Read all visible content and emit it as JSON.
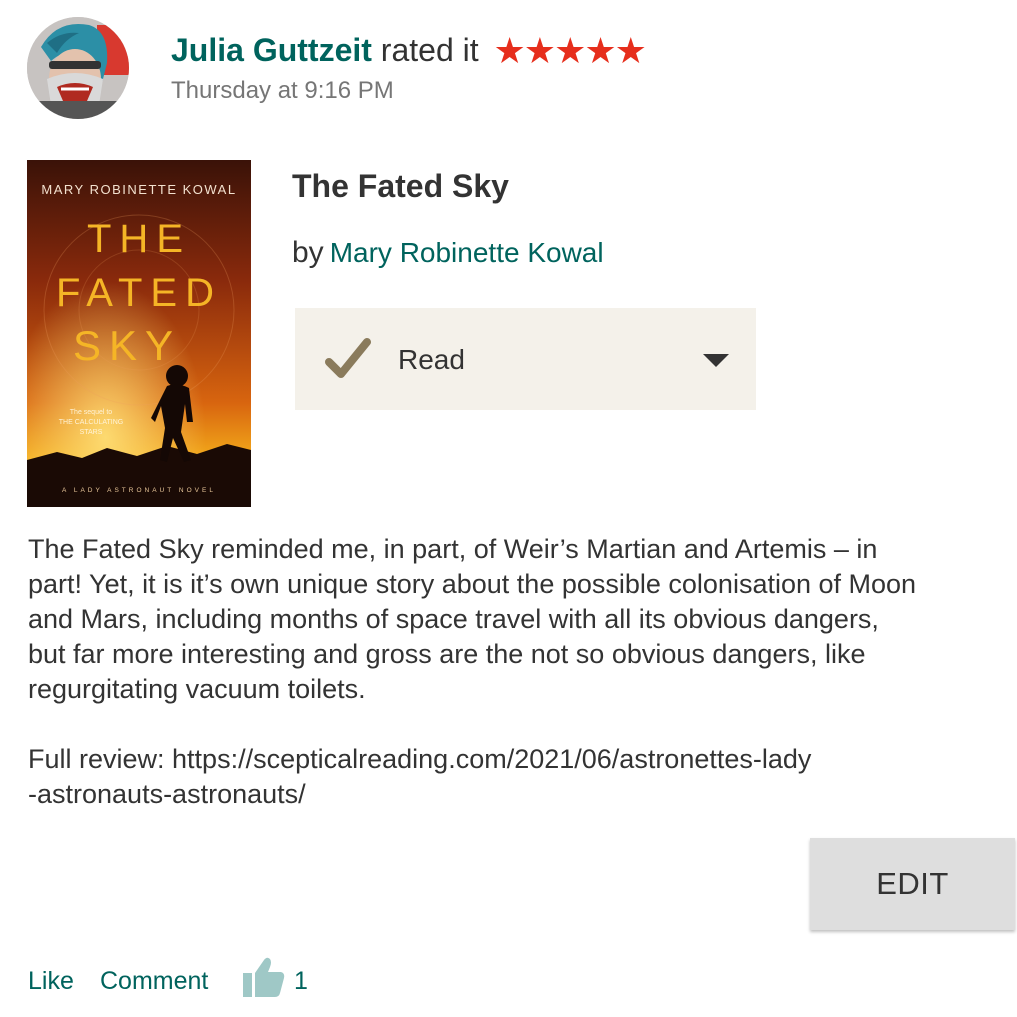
{
  "update": {
    "user_name": "Julia Guttzeit",
    "action_text": "rated it",
    "stars": "★★★★★",
    "timestamp": "Thursday at 9:16 PM"
  },
  "book": {
    "title": "The Fated Sky",
    "by_label": "by",
    "author": "Mary Robinette Kowal",
    "cover": {
      "author_line": "MARY ROBINETTE KOWAL",
      "title_line_1": "THE",
      "title_line_2": "FATED",
      "title_line_3": "SKY",
      "tagline_1": "The sequel to",
      "tagline_2": "THE CALCULATING",
      "tagline_3": "STARS",
      "series": "A LADY ASTRONAUT NOVEL"
    }
  },
  "shelf": {
    "label": "Read",
    "check_icon": "check-icon",
    "caret_icon": "caret-down-icon"
  },
  "review": {
    "body": "The Fated Sky reminded me, in part, of Weir’s Martian and Artemis – in\npart! Yet, it is it’s own unique story about the possible colonisation of Moon\nand Mars, including months of space travel with all its obvious dangers,\nbut far more interesting and gross are the not so obvious dangers, like\nregurgitating vacuum toilets.",
    "full_review": "Full review: https://scepticalreading.com/2021/06/astronettes-lady\n-astronauts-astronauts/"
  },
  "actions": {
    "edit_label": "EDIT",
    "like_label": "Like",
    "comment_label": "Comment",
    "like_count": "1"
  },
  "colors": {
    "link": "#00635d",
    "star": "#e62e1c",
    "shelf_bg": "#f4f1ea",
    "check": "#8a7b5c",
    "thumb": "#9fc8c6"
  }
}
